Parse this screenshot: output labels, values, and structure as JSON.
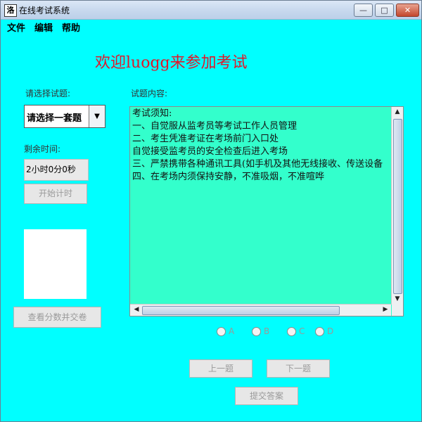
{
  "window": {
    "title": "在线考试系统",
    "app_icon": "洛",
    "controls": {
      "minimize": "—",
      "maximize": "□",
      "close": "✕"
    }
  },
  "menu": [
    "文件",
    "编辑",
    "帮助"
  ],
  "welcome": "欢迎luogg来参加考试",
  "labels": {
    "select_question": "请选择试题:",
    "content": "试题内容:",
    "remaining_time": "剩余时间:"
  },
  "combo": {
    "value": "请选择一套题",
    "arrow": "▼"
  },
  "timer": "2小时0分0秒",
  "buttons": {
    "start_timer": "开始计时",
    "view_score": "查看分数并交卷",
    "prev": "上一题",
    "next": "下一题",
    "submit": "提交答案"
  },
  "content_lines": [
    "考试须知:",
    "一、自觉服从监考员等考试工作人员管理",
    "二、考生凭准考证在考场前门入口处",
    "自觉接受监考员的安全检查后进入考场",
    "三、严禁携带各种通讯工具(如手机及其他无线接收、传送设备",
    "四、在考场内须保持安静，不准吸烟，不准喧哗"
  ],
  "options": [
    "A",
    "B",
    "C",
    "D"
  ],
  "colors": {
    "background": "#00ffff",
    "textarea": "#33ffcc",
    "welcome": "#e0182a"
  }
}
